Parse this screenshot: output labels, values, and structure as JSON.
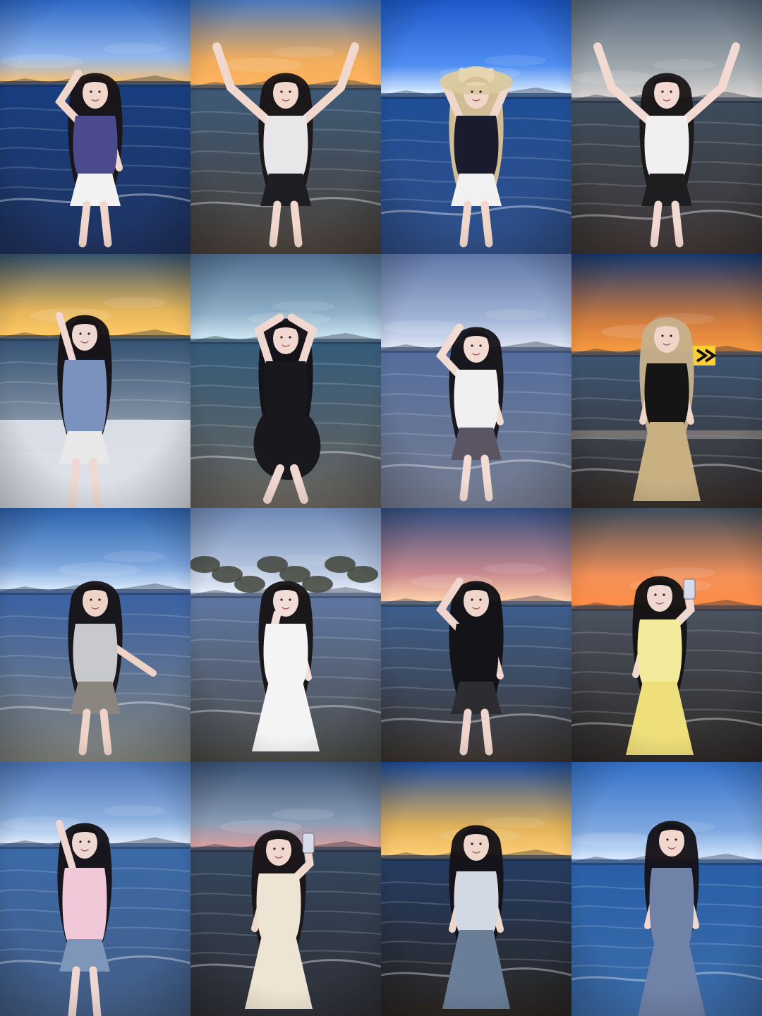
{
  "collage": {
    "rows": 4,
    "columns": 4,
    "photos": [
      {
        "sky_top": "#2e68c7",
        "sky_bottom": "#90b6ec",
        "sea": "#183f81",
        "shore": "#20335f",
        "glow": "#f4c07a",
        "top_color": "#4b4a8d",
        "bottom_color": "#f2f2f2",
        "hair": "#1a1415",
        "skin": "#f1d6cc",
        "pose": "arm-up"
      },
      {
        "sky_top": "#4a79bd",
        "sky_bottom": "#f0ad5d",
        "sea": "#3d5a79",
        "shore": "#4b4139",
        "glow": "#ffb35c",
        "top_color": "#e8e6e8",
        "bottom_color": "#1d1d22",
        "hair": "#1b1616",
        "skin": "#f1d7cc",
        "pose": "both-up"
      },
      {
        "sky_top": "#1d59c9",
        "sky_bottom": "#4f8ef2",
        "sea": "#1f4e96",
        "shore": "#304f87",
        "glow": "#d9ecff",
        "top_color": "#1a1c2d",
        "bottom_color": "#f1f1f1",
        "hair": "#d8c194",
        "skin": "#f1d6ca",
        "pose": "hat"
      },
      {
        "sky_top": "#586879",
        "sky_bottom": "#a1a9b0",
        "sea": "#3c4c5c",
        "shore": "#3f3634",
        "glow": "#d8d2cf",
        "top_color": "#f1efef",
        "bottom_color": "#1e1e20",
        "hair": "#1b1718",
        "skin": "#f2d9d2",
        "pose": "both-up"
      },
      {
        "sky_top": "#38546f",
        "sky_bottom": "#e6b65b",
        "sea": "#314e70",
        "shore": "#d7d7d9",
        "glow": "#ffc864",
        "top_color": "#7b92bf",
        "bottom_color": "#e8e8e8",
        "hair": "#151215",
        "skin": "#f0d8d2",
        "pose": "back"
      },
      {
        "sky_top": "#516e8f",
        "sky_bottom": "#8fb0c8",
        "sea": "#325a7b",
        "shore": "#6b655d",
        "glow": "#cfe6f2",
        "top_color": "#18181d",
        "bottom_color": "#18181d",
        "hair": "#141116",
        "skin": "#f0d7cf",
        "pose": "sitting"
      },
      {
        "sky_top": "#6178a8",
        "sky_bottom": "#a2b4d6",
        "sea": "#536c9d",
        "shore": "#777e91",
        "glow": "#dde5f5",
        "top_color": "#f0f0f1",
        "bottom_color": "#5b5563",
        "hair": "#171419",
        "skin": "#f2dbd3",
        "pose": "arm-up"
      },
      {
        "sky_top": "#17396f",
        "sky_bottom": "#d37d3e",
        "sea": "#3c5573",
        "shore": "#382f2a",
        "glow": "#f79a3f",
        "top_color": "#151516",
        "bottom_color": "#c8b083",
        "hair": "#c7b08a",
        "skin": "#efd5c7",
        "pose": "standing"
      },
      {
        "sky_top": "#2d63ad",
        "sky_bottom": "#7ba5dc",
        "sea": "#3760a4",
        "shore": "#83847d",
        "glow": "#d5e6fb",
        "top_color": "#c8c9cf",
        "bottom_color": "#8b857f",
        "hair": "#171417",
        "skin": "#efd3c7",
        "pose": "twirl"
      },
      {
        "sky_top": "#6f89b7",
        "sky_bottom": "#b3c3dd",
        "sea": "#5f77a4",
        "shore": "#4c4c47",
        "glow": "#e5edf9",
        "top_color": "#f4f4f4",
        "bottom_color": "#f4f4f4",
        "hair": "#181416",
        "skin": "#f3ddd8",
        "pose": "hand-face"
      },
      {
        "sky_top": "#334f82",
        "sky_bottom": "#c88a8e",
        "sea": "#3d5f8f",
        "shore": "#3e3631",
        "glow": "#ffd0a8",
        "top_color": "#141418",
        "bottom_color": "#2d2d31",
        "hair": "#121115",
        "skin": "#efd5cb",
        "pose": "arm-up"
      },
      {
        "sky_top": "#3d4d5c",
        "sky_bottom": "#f28f57",
        "sea": "#4a5360",
        "shore": "#2f2a28",
        "glow": "#ff8d45",
        "top_color": "#f3eb9c",
        "bottom_color": "#eedf7a",
        "hair": "#141214",
        "skin": "#f0d7cf",
        "pose": "phone"
      },
      {
        "sky_top": "#4b74b7",
        "sky_bottom": "#8db0df",
        "sea": "#3a6aa9",
        "shore": "#445d84",
        "glow": "#dce9fb",
        "top_color": "#f0c8d7",
        "bottom_color": "#7e96b7",
        "hair": "#161318",
        "skin": "#efd7d1",
        "pose": "back"
      },
      {
        "sky_top": "#3b5377",
        "sky_bottom": "#899bb4",
        "sea": "#34465e",
        "shore": "#2f3036",
        "glow": "#d7a0a1",
        "top_color": "#eee4d4",
        "bottom_color": "#eee4d4",
        "hair": "#1a1517",
        "skin": "#f0d8cf",
        "pose": "camera"
      },
      {
        "sky_top": "#1d4d9e",
        "sky_bottom": "#e2b25a",
        "sea": "#243c64",
        "shore": "#2b2621",
        "glow": "#ffcd73",
        "top_color": "#d2d8e4",
        "bottom_color": "#6b7e98",
        "hair": "#151217",
        "skin": "#efd6cb",
        "pose": "standing"
      },
      {
        "sky_top": "#3370c8",
        "sky_bottom": "#7fa8e0",
        "sea": "#295ea6",
        "shore": "#3c6daa",
        "glow": "#d6e8ff",
        "top_color": "#7082a8",
        "bottom_color": "#7082a8",
        "hair": "#161217",
        "skin": "#f1d7cf",
        "pose": "smile"
      }
    ]
  }
}
